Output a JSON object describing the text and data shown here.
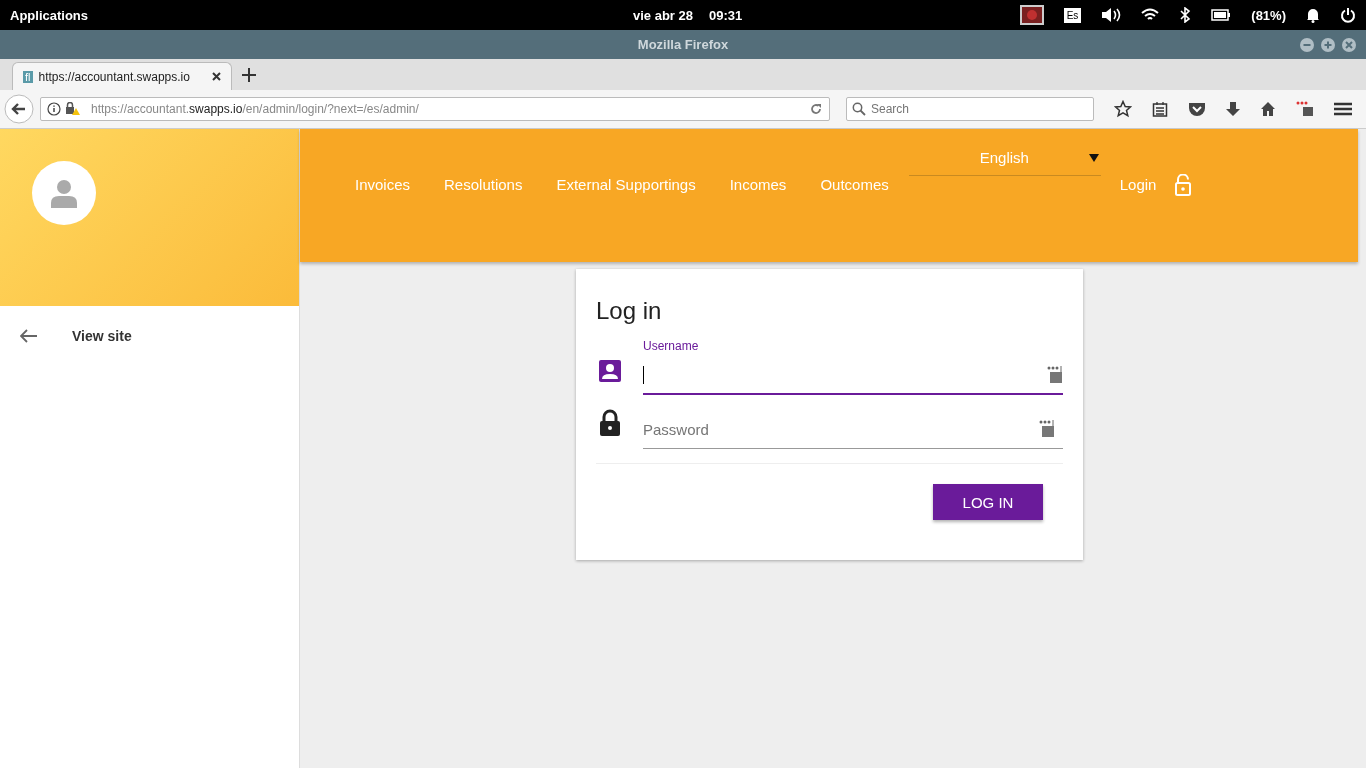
{
  "system_bar": {
    "menu": "Applications",
    "date": "vie abr 28",
    "time": "09:31",
    "keyboard": "Es",
    "battery": "(81%)"
  },
  "window": {
    "title": "Mozilla Firefox"
  },
  "browser": {
    "tab": {
      "title": "https://accountant.swapps.io",
      "favicon": "fl"
    },
    "url": {
      "prefix": "https://accountant.",
      "domain": "swapps.io",
      "suffix": "/en/admin/login/?next=/es/admin/"
    },
    "search": {
      "placeholder": "Search"
    }
  },
  "sidebar": {
    "items": [
      {
        "label": "View site"
      }
    ]
  },
  "header": {
    "nav": [
      "Invoices",
      "Resolutions",
      "External Supportings",
      "Incomes",
      "Outcomes"
    ],
    "language": "English",
    "login": "Login"
  },
  "form": {
    "title": "Log in",
    "fields": [
      {
        "kind": "user",
        "label": "Username",
        "focused": true
      },
      {
        "kind": "password",
        "placeholder": "Password",
        "focused": false
      }
    ],
    "button": "LOG IN"
  }
}
